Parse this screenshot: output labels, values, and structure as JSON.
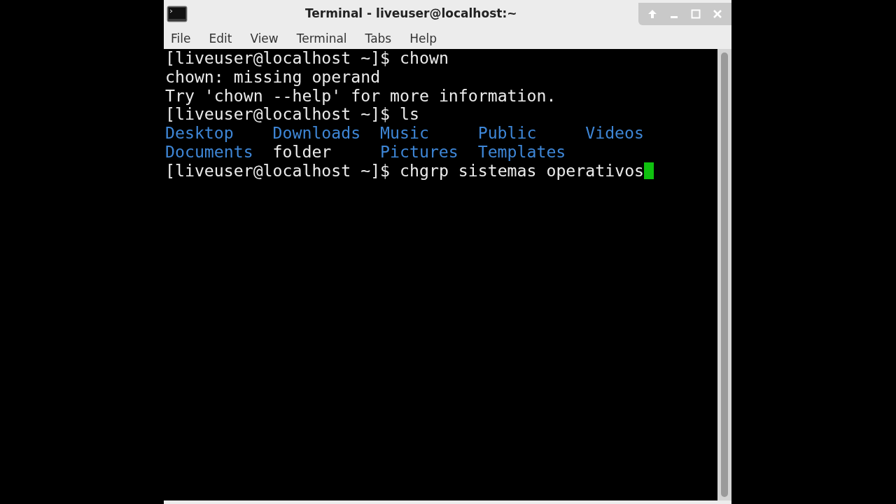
{
  "window": {
    "title": "Terminal - liveuser@localhost:~"
  },
  "menu": [
    "File",
    "Edit",
    "View",
    "Terminal",
    "Tabs",
    "Help"
  ],
  "terminal": {
    "lines": [
      {
        "kind": "prompt",
        "prompt": "[liveuser@localhost ~]$",
        "command": "chown",
        "cursor": false
      },
      {
        "kind": "output",
        "text": "chown: missing operand"
      },
      {
        "kind": "output",
        "text": "Try 'chown --help' for more information."
      },
      {
        "kind": "prompt",
        "prompt": "[liveuser@localhost ~]$",
        "command": "ls",
        "cursor": false
      },
      {
        "kind": "listing",
        "items": [
          {
            "name": "Desktop",
            "kind": "dir"
          },
          {
            "name": "Downloads",
            "kind": "dir"
          },
          {
            "name": "Music",
            "kind": "dir"
          },
          {
            "name": "Public",
            "kind": "dir"
          },
          {
            "name": "Videos",
            "kind": "dir"
          },
          {
            "name": "Documents",
            "kind": "dir"
          },
          {
            "name": "folder",
            "kind": "file"
          },
          {
            "name": "Pictures",
            "kind": "dir"
          },
          {
            "name": "Templates",
            "kind": "dir"
          }
        ]
      },
      {
        "kind": "prompt",
        "prompt": "[liveuser@localhost ~]$",
        "command": "chgrp sistemas operativos",
        "cursor": true
      }
    ]
  }
}
